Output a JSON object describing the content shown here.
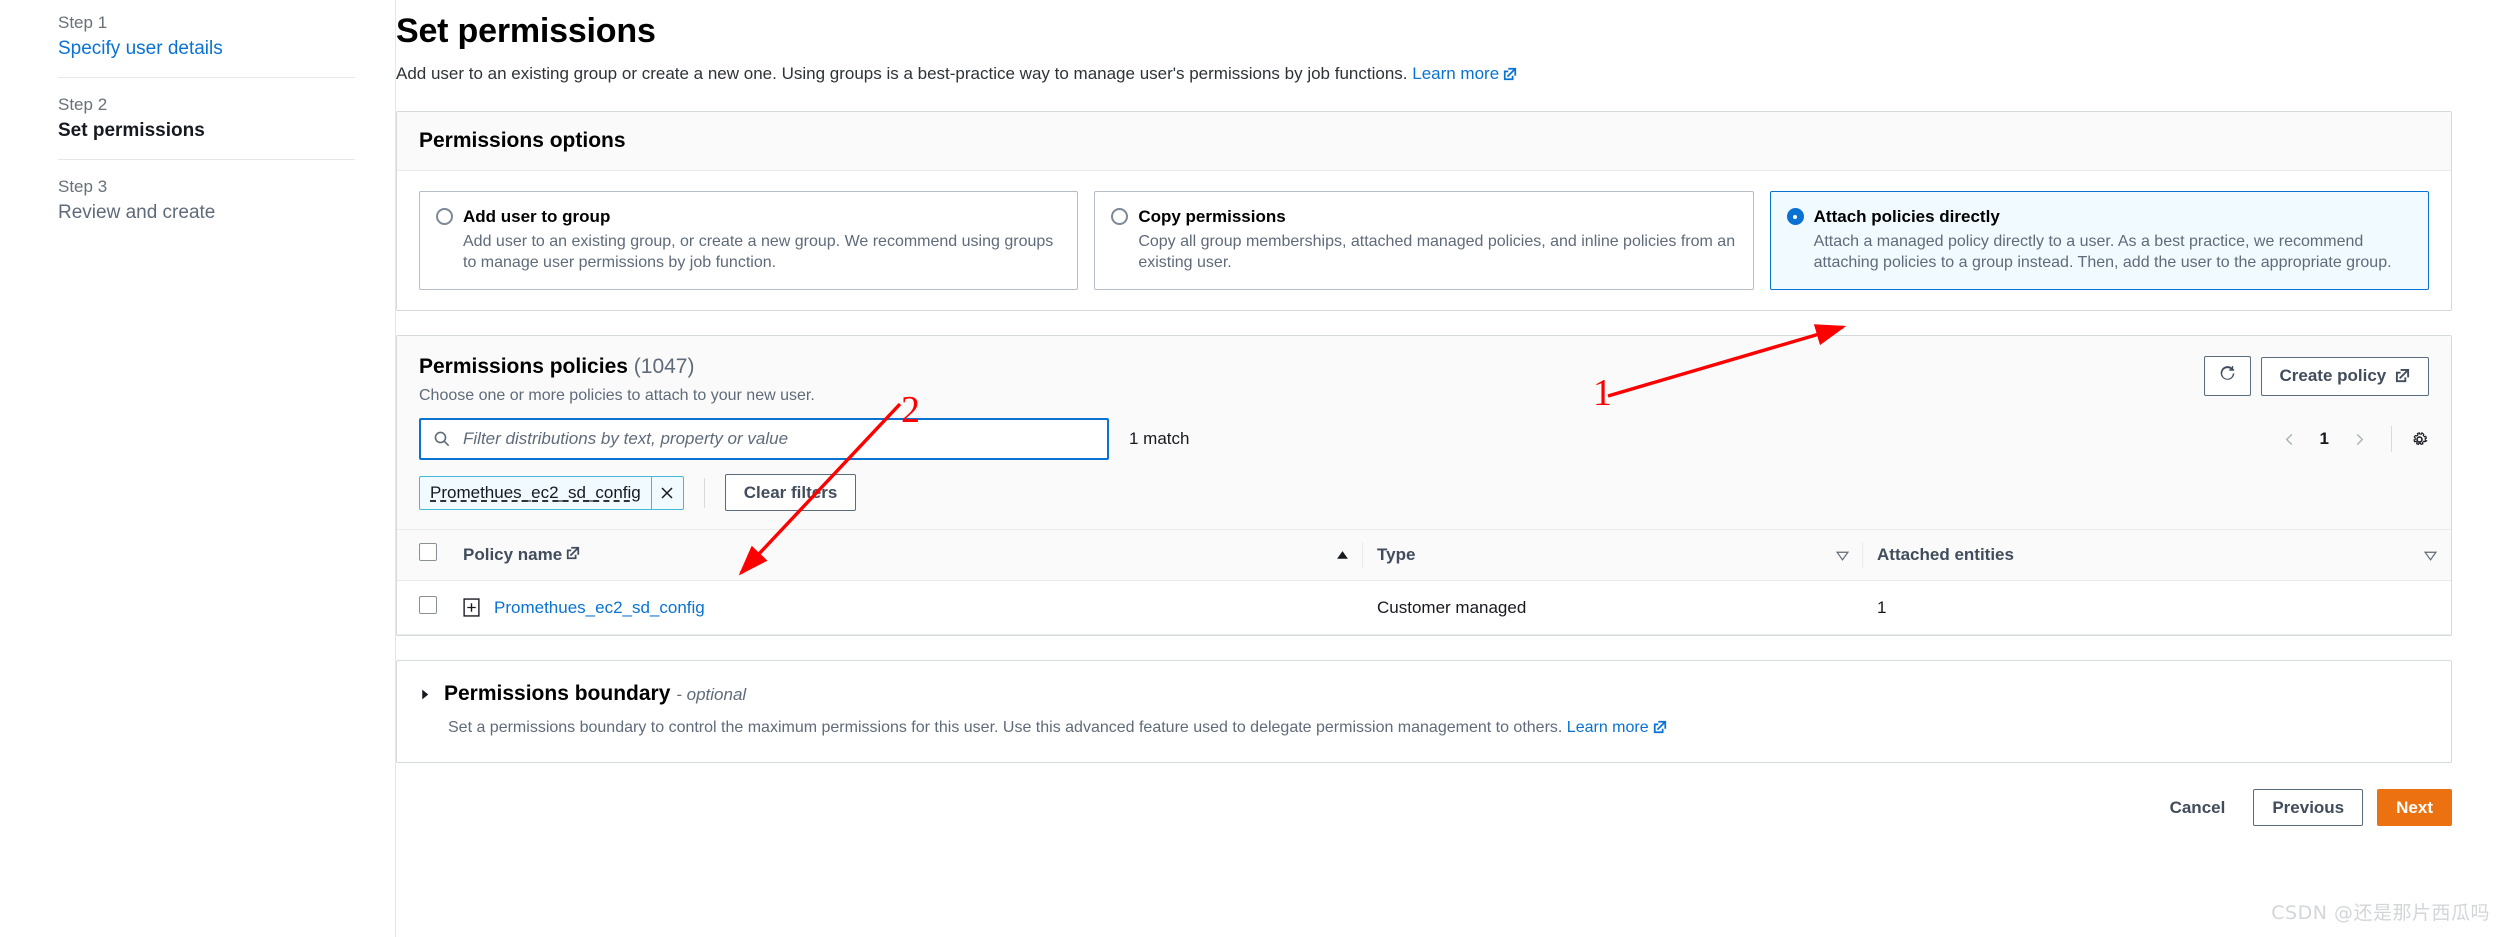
{
  "wizard": {
    "steps": [
      {
        "label": "Step 1",
        "name": "Specify user details",
        "state": "done"
      },
      {
        "label": "Step 2",
        "name": "Set permissions",
        "state": "current"
      },
      {
        "label": "Step 3",
        "name": "Review and create",
        "state": "upcoming"
      }
    ]
  },
  "header": {
    "title": "Set permissions",
    "description": "Add user to an existing group or create a new one. Using groups is a best-practice way to manage user's permissions by job functions.",
    "learn_more": "Learn more"
  },
  "permissions_options": {
    "title": "Permissions options",
    "cards": [
      {
        "title": "Add user to group",
        "description": "Add user to an existing group, or create a new group. We recommend using groups to manage user permissions by job function.",
        "selected": false
      },
      {
        "title": "Copy permissions",
        "description": "Copy all group memberships, attached managed policies, and inline policies from an existing user.",
        "selected": false
      },
      {
        "title": "Attach policies directly",
        "description": "Attach a managed policy directly to a user. As a best practice, we recommend attaching policies to a group instead. Then, add the user to the appropriate group.",
        "selected": true
      }
    ]
  },
  "policies": {
    "title": "Permissions policies",
    "count": "(1047)",
    "subtitle": "Choose one or more policies to attach to your new user.",
    "refresh_label": "refresh-icon",
    "create_policy_label": "Create policy",
    "search_placeholder": "Filter distributions by text, property or value",
    "search_value": "",
    "match_text": "1 match",
    "filter_token": "Promethues_ec2_sd_config",
    "clear_filters_label": "Clear filters",
    "pagination": {
      "page": "1"
    },
    "columns": [
      "Policy name",
      "Type",
      "Attached entities"
    ],
    "rows": [
      {
        "selected": false,
        "name": "Promethues_ec2_sd_config",
        "type": "Customer managed",
        "attached_entities": "1"
      }
    ]
  },
  "permissions_boundary": {
    "title": "Permissions boundary",
    "optional": "- optional",
    "description": "Set a permissions boundary to control the maximum permissions for this user. Use this advanced feature used to delegate permission management to others.",
    "learn_more": "Learn more"
  },
  "footer": {
    "cancel": "Cancel",
    "previous": "Previous",
    "next": "Next"
  },
  "annotations": [
    {
      "label": "1"
    },
    {
      "label": "2"
    }
  ],
  "watermark": "CSDN @还是那片西瓜吗",
  "colors": {
    "accent_blue": "#0972d3",
    "primary_orange": "#ec7211",
    "annotation_red": "#ff0000",
    "selected_card_bg": "#f1faff"
  }
}
